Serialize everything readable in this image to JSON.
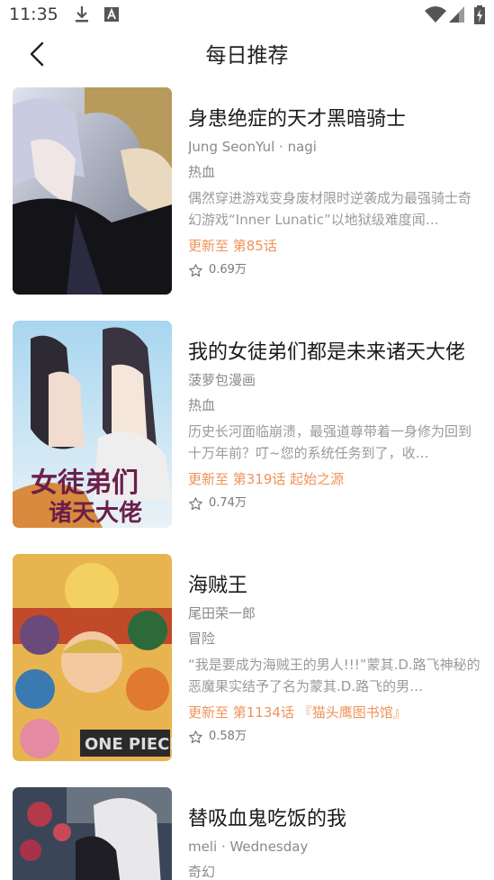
{
  "status": {
    "time": "11:35"
  },
  "header": {
    "title": "每日推荐"
  },
  "items": [
    {
      "title": "身患绝症的天才黑暗骑士",
      "author": "Jung SeonYul · nagi",
      "genre": "热血",
      "desc": "偶然穿进游戏变身废材限时逆袭成为最强骑士奇幻游戏“Inner Lunatic”以地狱级难度闻…",
      "update": "更新至 第85话",
      "favorites": "0.69万"
    },
    {
      "title": "我的女徒弟们都是未来诸天大佬",
      "author": "菠萝包漫画",
      "genre": "热血",
      "desc": "历史长河面临崩溃，最强道尊带着一身修为回到十万年前？叮~您的系统任务到了，收…",
      "update": "更新至 第319话 起始之源",
      "favorites": "0.74万"
    },
    {
      "title": "海贼王",
      "author": "尾田荣一郎",
      "genre": "冒险",
      "desc": "“我是要成为海贼王的男人!!!”蒙其.D.路飞神秘的恶魔果实结予了名为蒙其.D.路飞的男…",
      "update": "更新至 第1134话 『猫头鹰图书馆』",
      "favorites": "0.58万"
    },
    {
      "title": "替吸血鬼吃饭的我",
      "author": "meli · Wednesday",
      "genre": "奇幻",
      "desc": "",
      "update": "",
      "favorites": ""
    }
  ],
  "colors": {
    "accent": "#f0935a",
    "muted": "#8a8a8a"
  }
}
